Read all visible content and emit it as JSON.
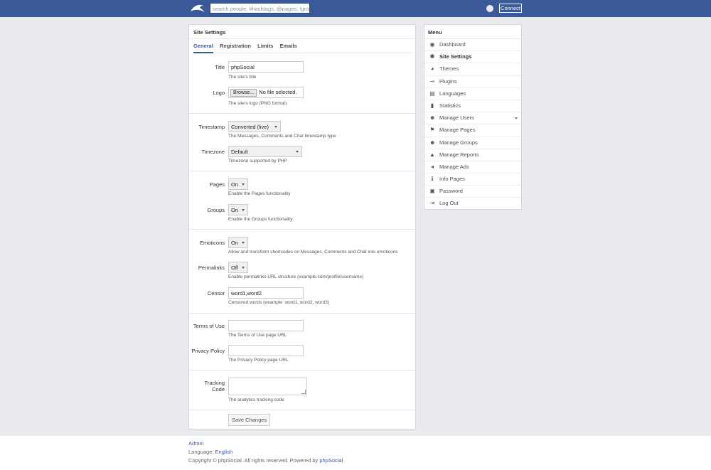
{
  "topbar": {
    "search_placeholder": "search people, #hashtags, @pages, !groups",
    "connect_label": "Connect"
  },
  "panel": {
    "title": "Site Settings",
    "tabs": [
      {
        "label": "General",
        "active": true
      },
      {
        "label": "Registration"
      },
      {
        "label": "Limits"
      },
      {
        "label": "Emails"
      }
    ]
  },
  "fields": {
    "title": {
      "label": "Title",
      "value": "phpSocial",
      "hint": "The site's title"
    },
    "logo": {
      "label": "Logo",
      "browse": "Browse...",
      "file_status": "No file selected.",
      "hint": "The site's logo (PNG format)"
    },
    "timestamp": {
      "label": "Timestamp",
      "value": "Converted (live)",
      "hint": "The Messages, Comments and Chat timestamp type"
    },
    "timezone": {
      "label": "Timezone",
      "value": "Default",
      "hint": "Timezone supported by PHP"
    },
    "pages": {
      "label": "Pages",
      "value": "On",
      "hint": "Enable the Pages functionality"
    },
    "groups": {
      "label": "Groups",
      "value": "On",
      "hint": "Enable the Groups functionality"
    },
    "emoticons": {
      "label": "Emoticons",
      "value": "On",
      "hint": "Allow and transform shortcodes on Messages, Comments and Chat into emoticons"
    },
    "permalinks": {
      "label": "Permalinks",
      "value": "Off",
      "hint": "Enable permalinks URL structure (example.com/profile/username)"
    },
    "censor": {
      "label": "Censor",
      "value": "word1,word2",
      "hint": "Censored words (example: word1, word2, word3)"
    },
    "terms": {
      "label": "Terms of Use",
      "value": "",
      "hint": "The Terms of Use page URL"
    },
    "privacy": {
      "label": "Privacy Policy",
      "value": "",
      "hint": "The Privacy Policy page URL"
    },
    "tracking": {
      "label_line1": "Tracking",
      "label_line2": "Code",
      "value": "",
      "hint": "The analytics tracking code"
    }
  },
  "save_label": "Save Changes",
  "menu": {
    "title": "Menu",
    "items": [
      {
        "label": "Dashboard",
        "icon": "dashboard-icon",
        "glyph": "◉"
      },
      {
        "label": "Site Settings",
        "icon": "gear-icon",
        "glyph": "✱",
        "active": true
      },
      {
        "label": "Themes",
        "icon": "palette-icon",
        "glyph": "◕"
      },
      {
        "label": "Plugins",
        "icon": "plug-icon",
        "glyph": "⊸"
      },
      {
        "label": "Languages",
        "icon": "chat-icon",
        "glyph": "▤"
      },
      {
        "label": "Statistics",
        "icon": "bar-chart-icon",
        "glyph": "▮"
      },
      {
        "label": "Manage Users",
        "icon": "user-icon",
        "glyph": "☻",
        "dropdown": true
      },
      {
        "label": "Manage Pages",
        "icon": "flag-icon",
        "glyph": "⚑"
      },
      {
        "label": "Manage Groups",
        "icon": "group-icon",
        "glyph": "☻"
      },
      {
        "label": "Manage Reports",
        "icon": "warning-icon",
        "glyph": "▲"
      },
      {
        "label": "Manage Ads",
        "icon": "megaphone-icon",
        "glyph": "◂"
      },
      {
        "label": "Info Pages",
        "icon": "info-icon",
        "glyph": "ℹ"
      },
      {
        "label": "Password",
        "icon": "lock-icon",
        "glyph": "▣"
      },
      {
        "label": "Log Out",
        "icon": "logout-icon",
        "glyph": "⇥"
      }
    ]
  },
  "footer": {
    "admin_link": "Admin",
    "language_prefix": "Language: ",
    "language_value": "English",
    "copyright": "Copyright © phpSocial. All rights reserved. Powered by ",
    "powered_link": "phpSocial"
  },
  "colors": {
    "brand": "#3b5998",
    "background": "#e9ebee"
  }
}
